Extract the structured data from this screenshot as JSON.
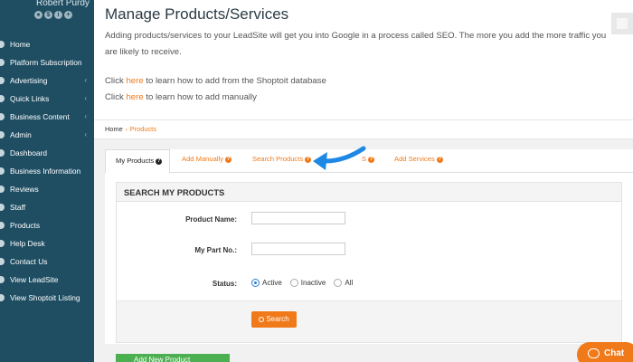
{
  "profile": {
    "name": "Robert Purdy",
    "icons": [
      "$",
      "i",
      "+"
    ]
  },
  "sidebar": {
    "items": [
      {
        "label": "Home",
        "has_children": false
      },
      {
        "label": "Platform Subscription",
        "has_children": false
      },
      {
        "label": "Advertising",
        "has_children": true
      },
      {
        "label": "Quick Links",
        "has_children": true
      },
      {
        "label": "Business Content",
        "has_children": true
      },
      {
        "label": "Admin",
        "has_children": true
      },
      {
        "label": "Dashboard",
        "has_children": false
      },
      {
        "label": "Business Information",
        "has_children": false
      },
      {
        "label": "Reviews",
        "has_children": false
      },
      {
        "label": "Staff",
        "has_children": false
      },
      {
        "label": "Products",
        "has_children": false
      },
      {
        "label": "Help Desk",
        "has_children": false
      },
      {
        "label": "Contact Us",
        "has_children": false
      },
      {
        "label": "View LeadSite",
        "has_children": false
      },
      {
        "label": "View Shoptoit Listing",
        "has_children": false
      }
    ]
  },
  "header": {
    "title": "Manage Products/Services",
    "intro": "Adding products/services to your LeadSite will get you into Google in a process called SEO. The more you add the more traffic you are likely to receive.",
    "link1_prefix": "Click ",
    "link1_text": "here",
    "link1_suffix": " to learn how to add from the Shoptoit database",
    "link2_prefix": "Click ",
    "link2_text": "here",
    "link2_suffix": " to learn how to add manually"
  },
  "breadcrumb": {
    "home": "Home",
    "separator": "›",
    "current": "Products"
  },
  "tabs": [
    {
      "label": "My Products",
      "active": true
    },
    {
      "label": "Add Manually",
      "active": false
    },
    {
      "label": "Search Products",
      "active": false
    },
    {
      "label": "S",
      "active": false
    },
    {
      "label": "Add Services",
      "active": false
    }
  ],
  "search_panel": {
    "title": "SEARCH MY PRODUCTS",
    "product_name_label": "Product Name:",
    "product_name_value": "",
    "part_no_label": "My Part No.:",
    "part_no_value": "",
    "status_label": "Status:",
    "status_options": [
      "Active",
      "Inactive",
      "All"
    ],
    "status_selected": "Active",
    "search_button": "Search"
  },
  "add_new_button": "Add New Product",
  "chat_button": "Chat",
  "colors": {
    "sidebar": "#1f4e63",
    "accent": "#f07a1a",
    "green": "#4caf50",
    "arrow": "#1e88e5"
  }
}
